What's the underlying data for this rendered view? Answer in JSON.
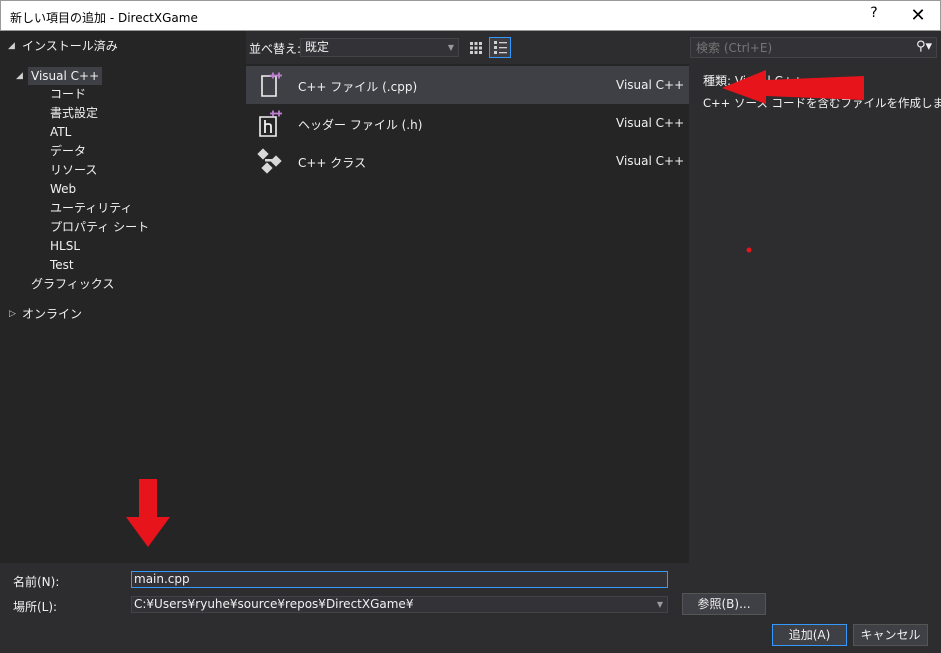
{
  "window": {
    "title": "新しい項目の追加 - DirectXGame",
    "help_glyph": "?",
    "close_glyph": "✕"
  },
  "tree": {
    "installed": "インストール済み",
    "visual_cpp": "Visual C++",
    "children": [
      "コード",
      "書式設定",
      "ATL",
      "データ",
      "リソース",
      "Web",
      "ユーティリティ",
      "プロパティ シート",
      "HLSL",
      "Test"
    ],
    "graphics": "グラフィックス",
    "online": "オンライン"
  },
  "toolbar": {
    "sort_label": "並べ替え:",
    "sort_value": "既定"
  },
  "search": {
    "placeholder": "検索 (Ctrl+E)"
  },
  "templates": [
    {
      "name": "C++ ファイル (.cpp)",
      "lang": "Visual C++",
      "icon": "cpp-file-icon",
      "selected": true
    },
    {
      "name": "ヘッダー ファイル (.h)",
      "lang": "Visual C++",
      "icon": "header-file-icon",
      "selected": false
    },
    {
      "name": "C++ クラス",
      "lang": "Visual C++",
      "icon": "cpp-class-icon",
      "selected": false
    }
  ],
  "details": {
    "kind": "種類: Visual C++",
    "description": "C++ ソース コードを含むファイルを作成します"
  },
  "form": {
    "name_label": "名前(N):",
    "name_value": "main.cpp",
    "location_label": "場所(L):",
    "location_value": "C:¥Users¥ryuhe¥source¥repos¥DirectXGame¥",
    "browse_button": "参照(B)...",
    "add_button": "追加(A)",
    "cancel_button": "キャンセル"
  },
  "colors": {
    "background": "#2d2d30",
    "panel": "#252526",
    "selection": "#3f3f46",
    "accent": "#3399ff",
    "annotation_red": "#e8141c",
    "icon_purple": "#c07fd1"
  }
}
